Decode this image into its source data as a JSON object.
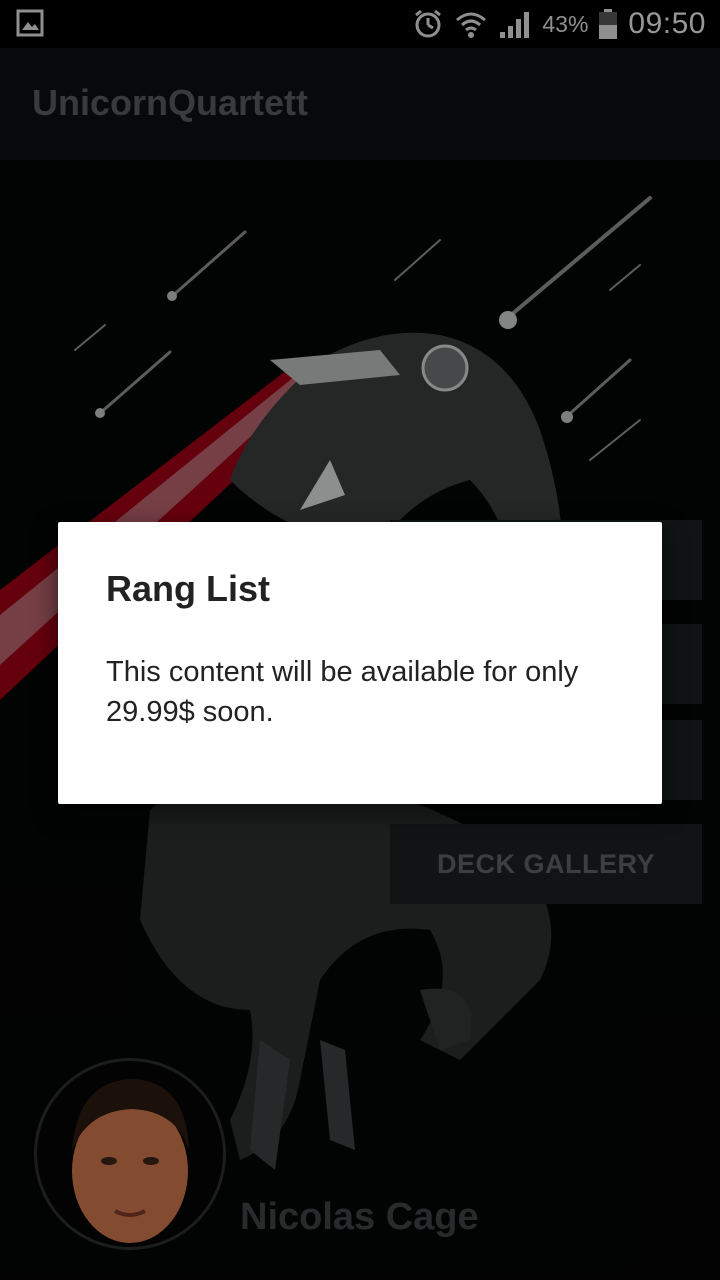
{
  "status_bar": {
    "left_icon": "gallery-icon",
    "icons": [
      "alarm-icon",
      "wifi-icon",
      "signal-icon"
    ],
    "battery_percent": "43%",
    "time": "09:50"
  },
  "app_bar": {
    "title": "UnicornQuartett"
  },
  "menu": {
    "deck_gallery_label": "DECK GALLERY"
  },
  "profile": {
    "name": "Nicolas Cage"
  },
  "dialog": {
    "title": "Rang List",
    "message": "This content will be available for only 29.99$ soon."
  },
  "colors": {
    "app_bar_bg": "#0c1010",
    "dialog_bg": "#ffffff",
    "laser": "#c4001a"
  }
}
